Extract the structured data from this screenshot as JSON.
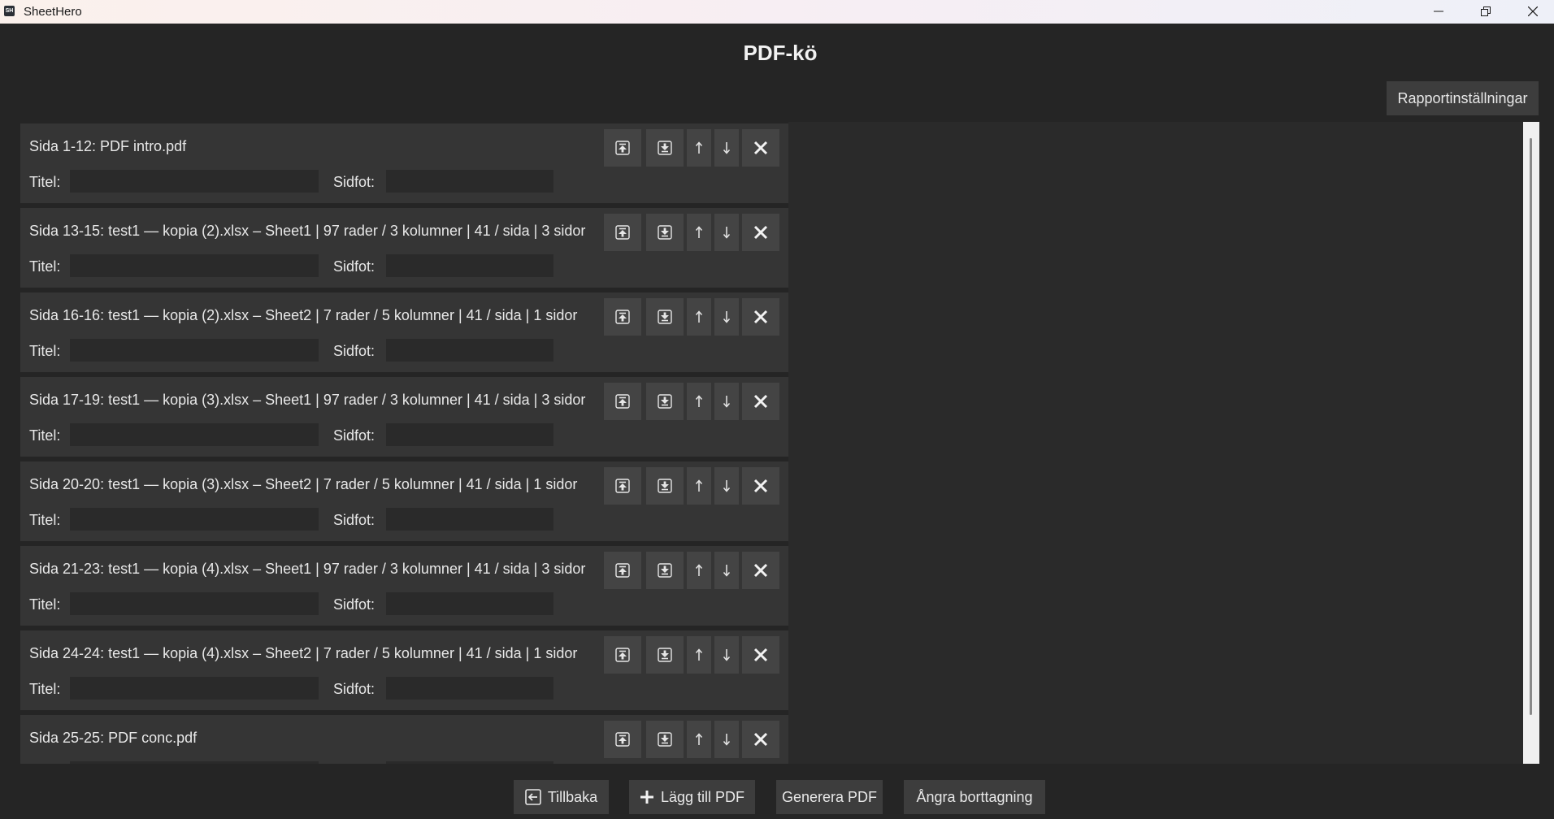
{
  "window": {
    "app_name": "SheetHero",
    "icon_text": "SH"
  },
  "page": {
    "title": "PDF-kö",
    "settings_button": "Rapportinställningar"
  },
  "labels": {
    "title_field": "Titel:",
    "footer_field": "Sidfot:"
  },
  "queue": [
    {
      "label": "Sida 1-12: PDF intro.pdf",
      "title_value": "",
      "footer_value": ""
    },
    {
      "label": "Sida 13-15: test1 — kopia (2).xlsx – Sheet1 | 97 rader / 3 kolumner | 41 / sida | 3 sidor",
      "title_value": "",
      "footer_value": ""
    },
    {
      "label": "Sida 16-16: test1 — kopia (2).xlsx – Sheet2 | 7 rader / 5 kolumner | 41 / sida | 1 sidor",
      "title_value": "",
      "footer_value": ""
    },
    {
      "label": "Sida 17-19: test1 — kopia (3).xlsx – Sheet1 | 97 rader / 3 kolumner | 41 / sida | 3 sidor",
      "title_value": "",
      "footer_value": ""
    },
    {
      "label": "Sida 20-20: test1 — kopia (3).xlsx – Sheet2 | 7 rader / 5 kolumner | 41 / sida | 1 sidor",
      "title_value": "",
      "footer_value": ""
    },
    {
      "label": "Sida 21-23: test1 — kopia (4).xlsx – Sheet1 | 97 rader / 3 kolumner | 41 / sida | 3 sidor",
      "title_value": "",
      "footer_value": ""
    },
    {
      "label": "Sida 24-24: test1 — kopia (4).xlsx – Sheet2 | 7 rader / 5 kolumner | 41 / sida | 1 sidor",
      "title_value": "",
      "footer_value": ""
    },
    {
      "label": "Sida 25-25: PDF conc.pdf",
      "title_value": "",
      "footer_value": ""
    }
  ],
  "footer_buttons": {
    "back": "Tillbaka",
    "add_pdf": "Lägg till PDF",
    "generate": "Generera PDF",
    "undo_delete": "Ångra borttagning"
  },
  "icons": {
    "move_top": "move-to-top-icon",
    "move_bottom": "move-to-bottom-icon",
    "move_up": "arrow-up-icon",
    "move_down": "arrow-down-icon",
    "remove": "close-icon",
    "back": "back-icon",
    "add": "plus-icon"
  }
}
